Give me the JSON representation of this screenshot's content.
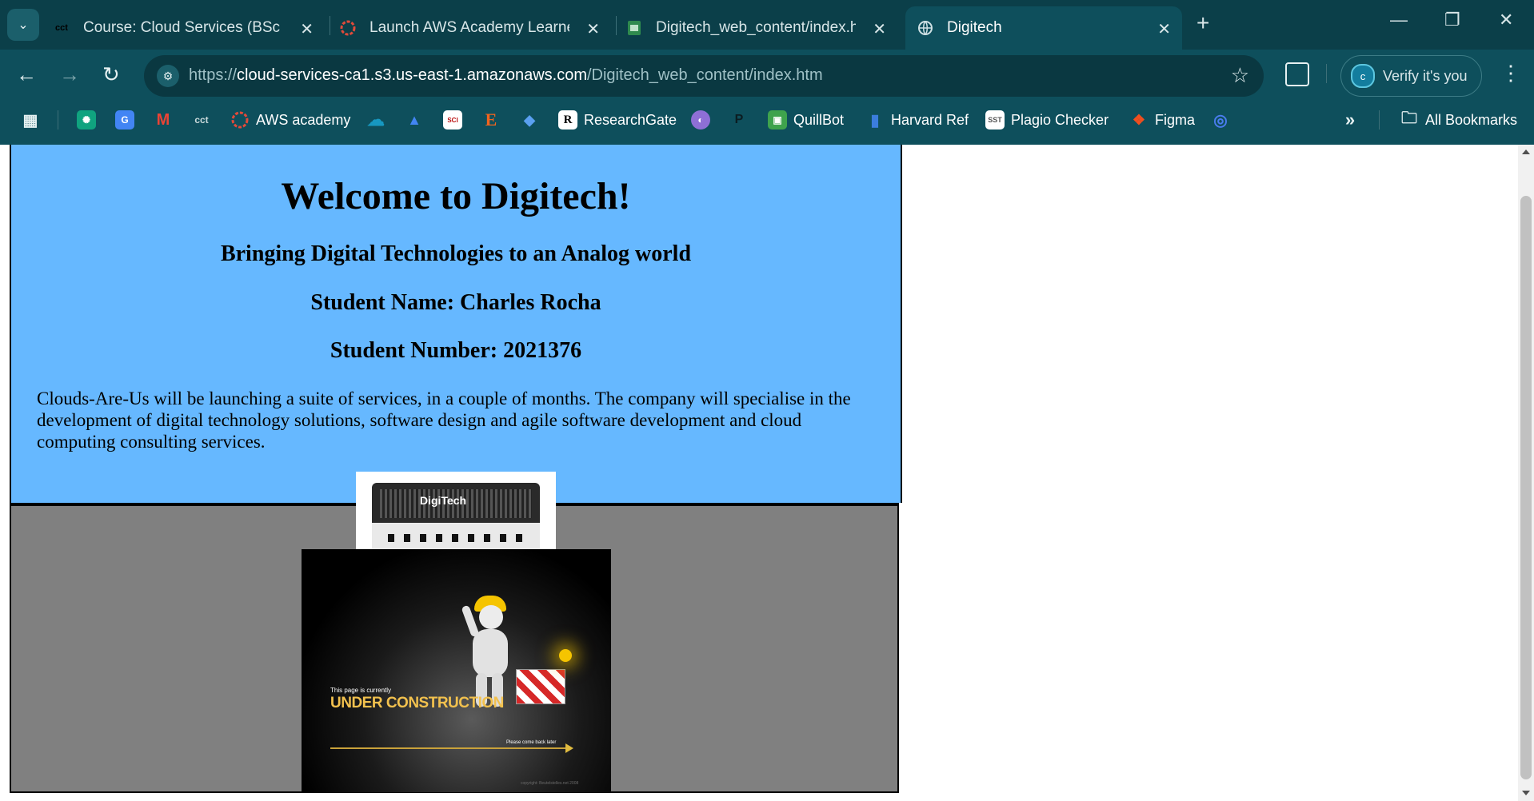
{
  "browser": {
    "tabs": [
      {
        "favicon": "cct",
        "title": "Course: Cloud Services (BSc (Ho",
        "active": false
      },
      {
        "favicon": "aws-academy-icon",
        "title": "Launch AWS Academy Learner L",
        "active": false
      },
      {
        "favicon": "html-file-icon",
        "title": "Digitech_web_content/index.htm",
        "active": false
      },
      {
        "favicon": "globe-icon",
        "title": "Digitech",
        "active": true
      }
    ],
    "url": {
      "scheme": "https://",
      "host": "cloud-services-ca1.s3.us-east-1.amazonaws.com",
      "path": "/Digitech_web_content/index.htm"
    },
    "profile": {
      "initial": "c",
      "label": "Verify it's you"
    },
    "bookmarks": [
      {
        "icon": "apps-icon",
        "label": ""
      },
      {
        "icon": "chatgpt-icon",
        "label": ""
      },
      {
        "icon": "google-translate-icon",
        "label": ""
      },
      {
        "icon": "gmail-icon",
        "label": ""
      },
      {
        "icon": "cct",
        "label": ""
      },
      {
        "icon": "aws-academy-icon",
        "label": "AWS academy"
      },
      {
        "icon": "salesforce-icon",
        "label": ""
      },
      {
        "icon": "drive-icon",
        "label": ""
      },
      {
        "icon": "sci-hub-icon",
        "label": ""
      },
      {
        "icon": "etsy-icon",
        "label": ""
      },
      {
        "icon": "graduation-icon",
        "label": ""
      },
      {
        "icon": "researchgate-icon",
        "label": "ResearchGate"
      },
      {
        "icon": "planet-icon",
        "label": ""
      },
      {
        "icon": "pixabay-icon",
        "label": ""
      },
      {
        "icon": "quillbot-icon",
        "label": "QuillBot"
      },
      {
        "icon": "bookmark-icon",
        "label": "Harvard Ref"
      },
      {
        "icon": "sst-icon",
        "label": "Plagio Checker"
      },
      {
        "icon": "figma-icon",
        "label": "Figma"
      },
      {
        "icon": "fingerprint-icon",
        "label": ""
      }
    ],
    "all_bookmarks_label": "All Bookmarks",
    "colors": {
      "frame": "#0b3f49",
      "toolbar": "#0e4f5c"
    }
  },
  "page": {
    "heading": "Welcome to Digitech!",
    "tagline": "Bringing Digital Technologies to an Analog world",
    "student_name": "Student Name: Charles Rocha",
    "student_number": "Student Number: 2021376",
    "description": "Clouds-Are-Us will be launching a suite of services, in a couple of months. The company will specialise in the development of digital technology solutions, software design and agile software development and cloud computing consulting services.",
    "amp_logo": "DigiTech",
    "construction": {
      "small_text": "This page is currently",
      "big_text": "UNDER CONSTRUCTION",
      "back_text": "Please come back later",
      "copyright": "copyright: Beutelstelles.net 2008"
    },
    "colors": {
      "hero_bg": "#66b8ff",
      "lower_bg": "#808080"
    }
  }
}
